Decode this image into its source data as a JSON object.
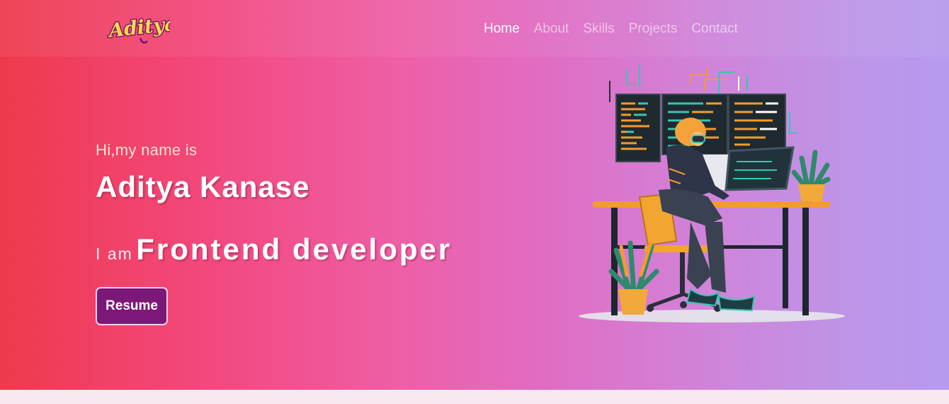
{
  "header": {
    "logo_text": "Aditya",
    "nav": [
      {
        "label": "Home",
        "active": true
      },
      {
        "label": "About",
        "active": false
      },
      {
        "label": "Skills",
        "active": false
      },
      {
        "label": "Projects",
        "active": false
      },
      {
        "label": "Contact",
        "active": false
      }
    ]
  },
  "hero": {
    "greeting": "Hi,my name is",
    "name": "Aditya Kanase",
    "role_prefix": "I am",
    "role": "Frontend developer",
    "resume_label": "Resume",
    "illustration": "developer-at-desk-illustration"
  },
  "colors": {
    "gradient_start": "#ee3a4d",
    "gradient_mid": "#ee5fa6",
    "gradient_end": "#b69aee",
    "button_bg": "#7c1877",
    "greeting_text": "#fde3cf"
  }
}
